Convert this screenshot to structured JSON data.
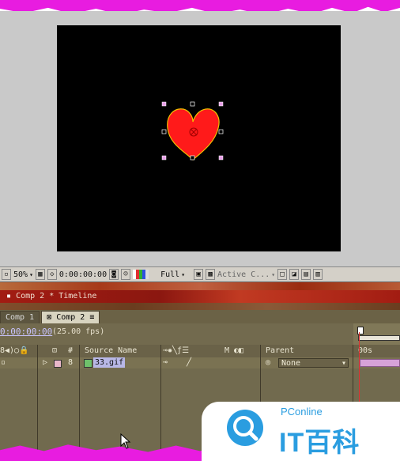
{
  "viewer": {
    "zoom": "50%",
    "timecode": "0:00:00:00",
    "resolution": "Full",
    "camera": "Active C..."
  },
  "timeline": {
    "title": "Comp 2 * Timeline",
    "tabs": [
      {
        "label": "Comp 1"
      },
      {
        "label": "Comp 2"
      }
    ],
    "current_time": "0:00:00:00",
    "fps": "(25.00 fps)",
    "headers": {
      "number": "#",
      "source_name": "Source Name",
      "switch_m": "M",
      "parent": "Parent",
      "ruler_start": "00s"
    },
    "layers": [
      {
        "index": "8",
        "source_name": "33.gif",
        "parent": "None",
        "label_color": "#e9b7c9"
      }
    ]
  },
  "watermark": {
    "small": "PConline",
    "big": "IT百科"
  },
  "colors": {
    "torn_edge": "#e81ce0",
    "heart_fill": "#ff1a1a",
    "heart_outline": "#f2c200",
    "title_bar": "#a21c12",
    "brand_blue": "#2a9de0"
  }
}
